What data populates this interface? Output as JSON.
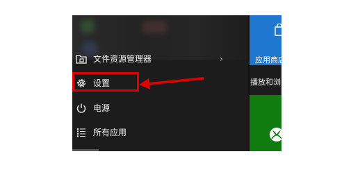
{
  "start_menu": {
    "items": [
      {
        "label": "文件资源管理器",
        "icon": "folder-icon",
        "has_submenu": true
      },
      {
        "label": "设置",
        "icon": "gear-icon",
        "has_submenu": false
      },
      {
        "label": "电源",
        "icon": "power-icon",
        "has_submenu": false
      },
      {
        "label": "所有应用",
        "icon": "list-icon",
        "has_submenu": false
      }
    ],
    "submenu_indicator": "›"
  },
  "tiles": {
    "store_label": "应用商店",
    "group_label": "播放和浏览"
  },
  "colors": {
    "menu_bg": "#1c1c1c",
    "store_tile": "#1f77d0",
    "xbox_tile": "#107c10",
    "annotation": "#e00000"
  }
}
